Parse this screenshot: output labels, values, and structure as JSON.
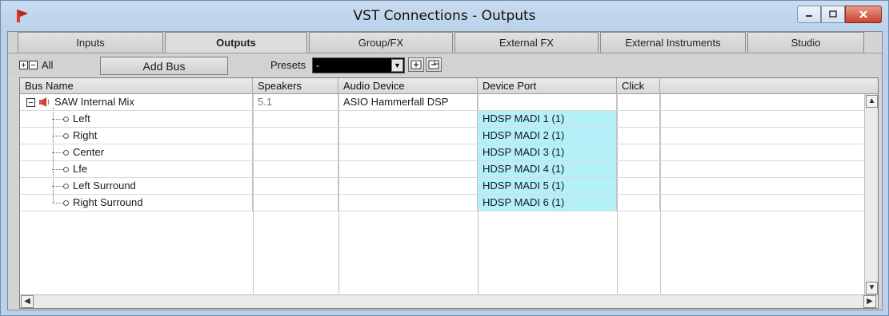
{
  "window": {
    "title": "VST Connections - Outputs"
  },
  "tabs": [
    {
      "label": "Inputs"
    },
    {
      "label": "Outputs"
    },
    {
      "label": "Group/FX"
    },
    {
      "label": "External FX"
    },
    {
      "label": "External Instruments"
    },
    {
      "label": "Studio"
    }
  ],
  "toolbar": {
    "all_label": "All",
    "add_bus_label": "Add Bus",
    "presets_label": "Presets",
    "presets_value": "-"
  },
  "table": {
    "headers": [
      "Bus Name",
      "Speakers",
      "Audio Device",
      "Device Port",
      "Click"
    ],
    "bus": {
      "name": "SAW Internal Mix",
      "speakers": "5.1",
      "audio_device": "ASIO Hammerfall DSP"
    },
    "channels": [
      {
        "name": "Left",
        "port": "HDSP MADI 1 (1)"
      },
      {
        "name": "Right",
        "port": "HDSP MADI 2 (1)"
      },
      {
        "name": "Center",
        "port": "HDSP MADI 3 (1)"
      },
      {
        "name": "Lfe",
        "port": "HDSP MADI 4 (1)"
      },
      {
        "name": "Left Surround",
        "port": "HDSP MADI 5 (1)"
      },
      {
        "name": "Right Surround",
        "port": "HDSP MADI 6 (1)"
      }
    ]
  },
  "colors": {
    "port_highlight": "#b4f0f8",
    "title_bar": "#b9d1ea",
    "close_button": "#c8432c"
  },
  "icons": {
    "app": "cubase-logo-icon",
    "bus": "speaker-icon",
    "channel": "output-port-icon"
  }
}
